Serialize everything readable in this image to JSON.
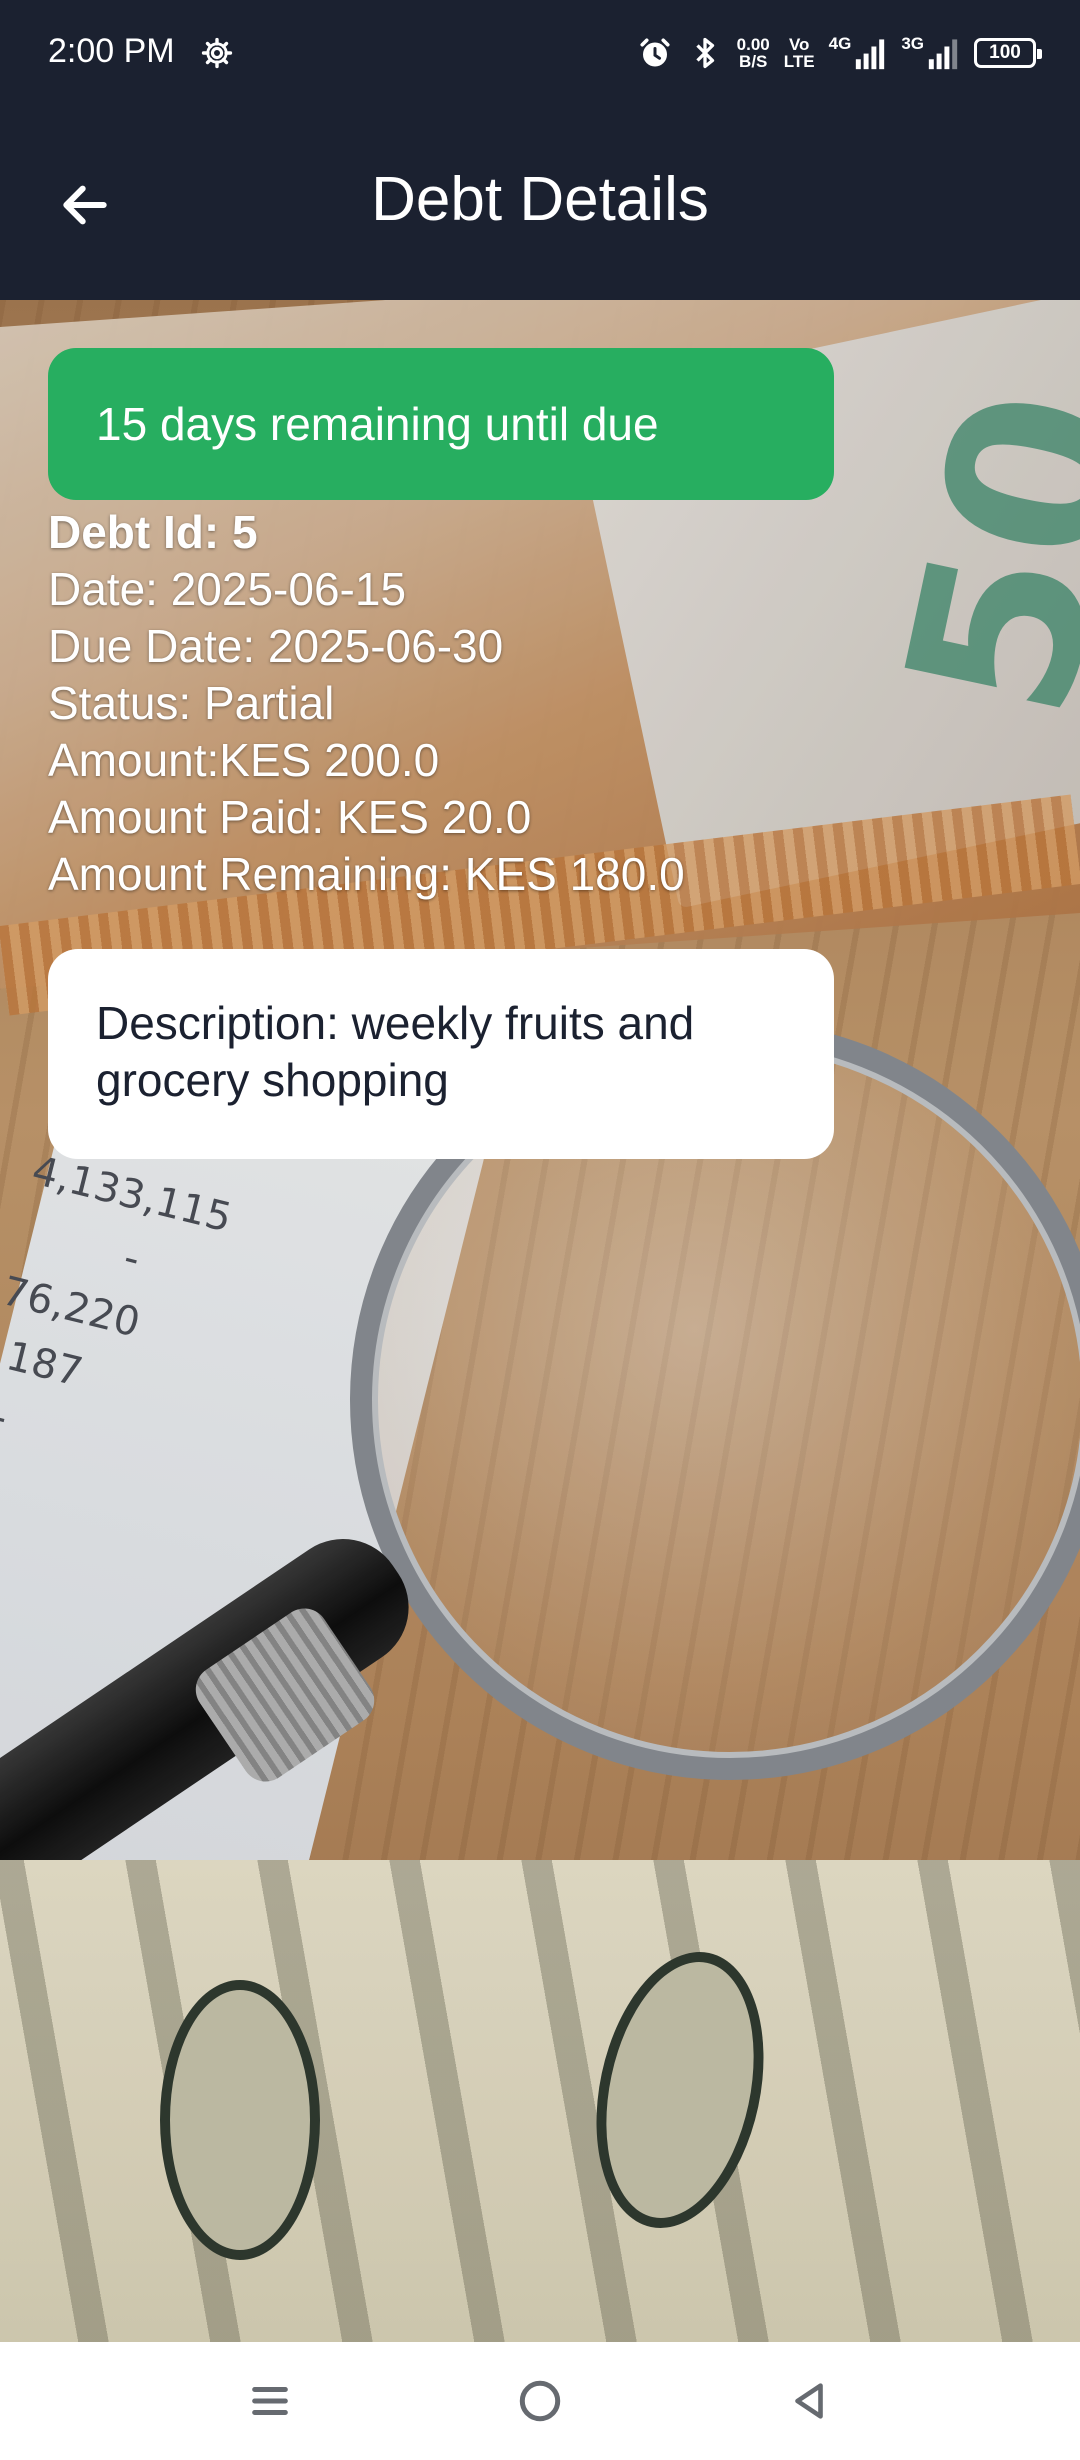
{
  "status_bar": {
    "time": "2:00 PM",
    "net_speed_value": "0.00",
    "net_speed_unit": "B/S",
    "volte_top": "Vo",
    "volte_bottom": "LTE",
    "sim1_label": "4G",
    "sim2_label": "3G",
    "battery": "100"
  },
  "app_bar": {
    "title": "Debt Details"
  },
  "due_banner": {
    "text": "15 days remaining until due",
    "color": "#27ae60"
  },
  "debt": {
    "id_line": "Debt Id: 5",
    "date_line": "Date: 2025-06-15",
    "due_date_line": "Due Date: 2025-06-30",
    "status_line": "Status: Partial",
    "amount_line": "Amount:KES 200.0",
    "amount_paid_line": "Amount Paid: KES 20.0",
    "amount_remaining_line": "Amount Remaining: KES 180.0"
  },
  "description": {
    "text": "Description: weekly fruits and grocery shopping"
  },
  "background_image": {
    "note_denomination": "50",
    "paper_numbers": [
      "4,133,115",
      "-",
      "76,220",
      "187",
      "-"
    ]
  },
  "nav_bar": {
    "menu_icon": "menu-icon",
    "home_icon": "home-circle-icon",
    "back_icon": "back-triangle-icon"
  },
  "colors": {
    "header": "#1b2130",
    "banner": "#27ae60",
    "card": "#ffffff"
  }
}
